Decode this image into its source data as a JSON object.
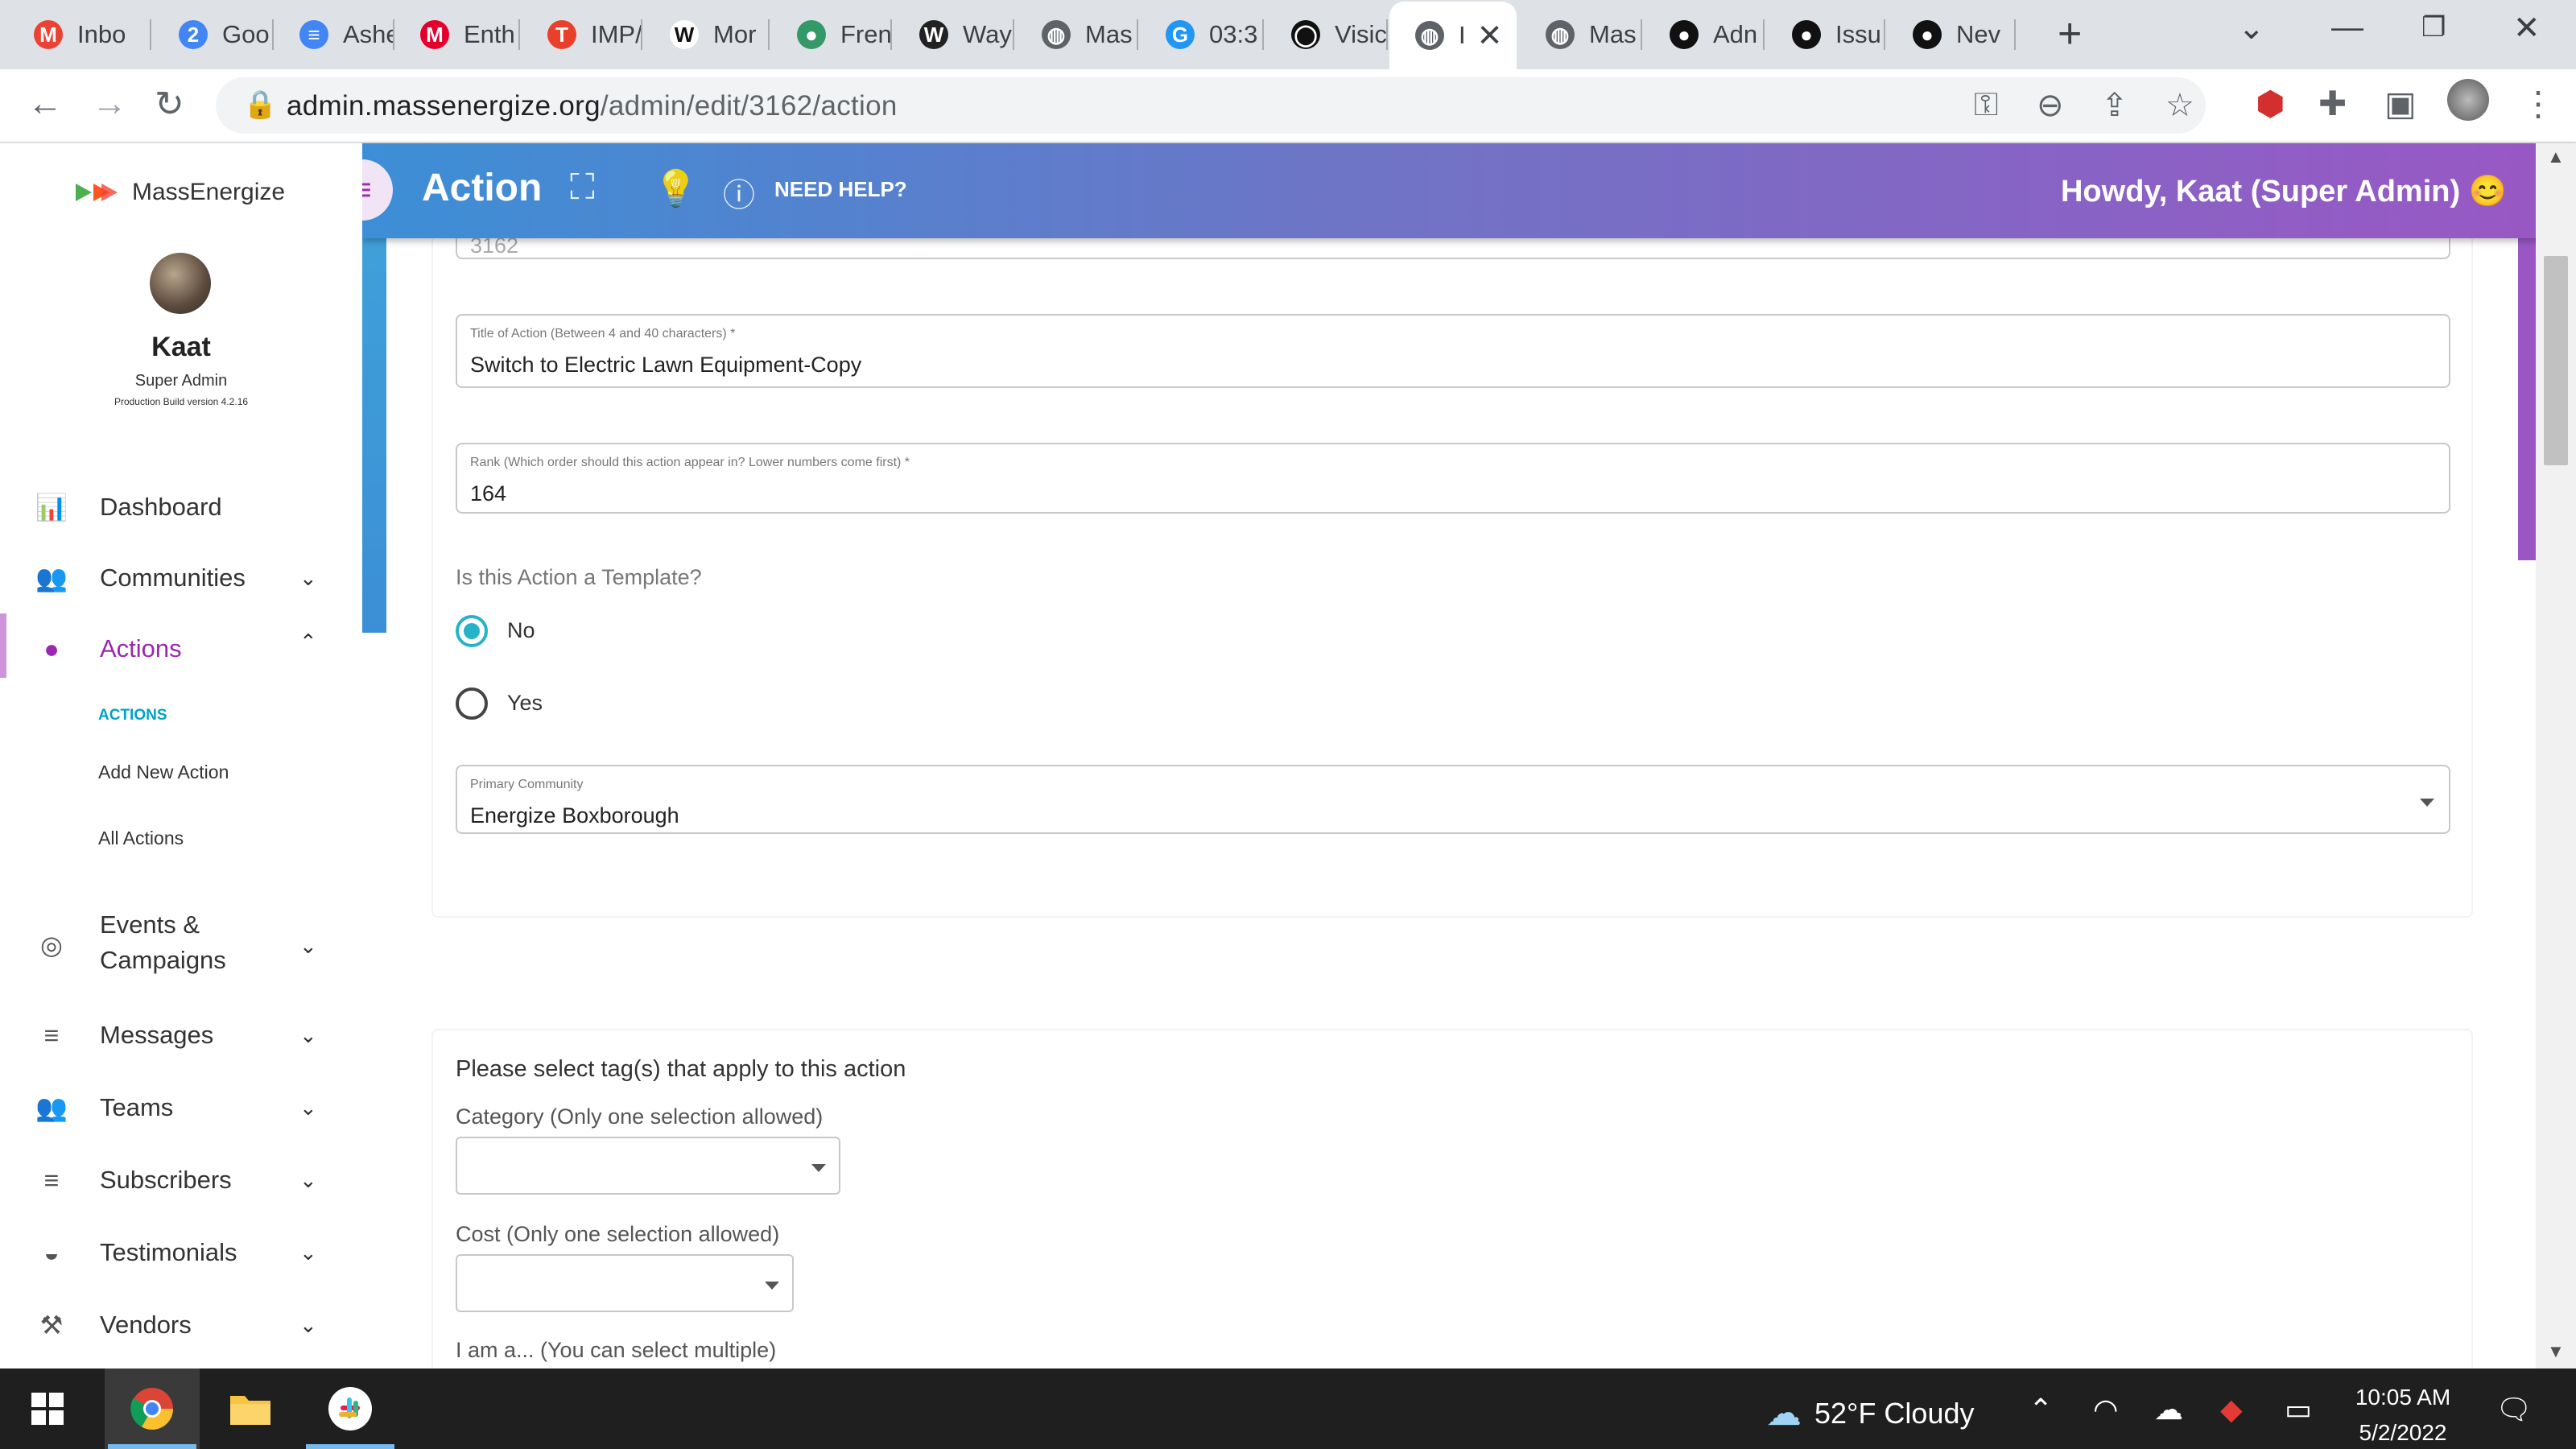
{
  "browser": {
    "tabs": [
      {
        "title": "Inbo",
        "icon": "gmail-icon",
        "color": "#ea4335",
        "glyph": "M"
      },
      {
        "title": "Goo",
        "icon": "google-calendar-icon",
        "color": "#4285f4",
        "glyph": "2"
      },
      {
        "title": "Ashe",
        "icon": "google-docs-icon",
        "color": "#4285f4",
        "glyph": "≡"
      },
      {
        "title": "Enth",
        "icon": "met-icon",
        "color": "#e4002b",
        "glyph": "M"
      },
      {
        "title": "IMP/",
        "icon": "t-icon",
        "color": "#e8402a",
        "glyph": "T"
      },
      {
        "title": "Mor",
        "icon": "wikipedia-icon",
        "color": "#ffffff",
        "glyph": "W"
      },
      {
        "title": "Fren",
        "icon": "wikimedia-icon",
        "color": "#339966",
        "glyph": "●"
      },
      {
        "title": "Way",
        "icon": "wayback-icon",
        "color": "#222222",
        "glyph": "W"
      },
      {
        "title": "Mas",
        "icon": "globe-icon",
        "color": "#5f6368",
        "glyph": "◍"
      },
      {
        "title": "03:3",
        "icon": "g-icon",
        "color": "#2196f3",
        "glyph": "G"
      },
      {
        "title": "Visic",
        "icon": "circle-icon",
        "color": "#111111",
        "glyph": "◯"
      },
      {
        "title": "I",
        "icon": "globe-icon",
        "color": "#5f6368",
        "glyph": "◍"
      },
      {
        "title": "Mas",
        "icon": "globe-icon",
        "color": "#5f6368",
        "glyph": "◍"
      },
      {
        "title": "Adn",
        "icon": "github-icon",
        "color": "#111111",
        "glyph": "●"
      },
      {
        "title": "Issu",
        "icon": "github-icon",
        "color": "#111111",
        "glyph": "●"
      },
      {
        "title": "Nev",
        "icon": "github-icon",
        "color": "#111111",
        "glyph": "●"
      }
    ],
    "url_host": "admin.massenergize.org",
    "url_path": "/admin/edit/3162/action"
  },
  "sidebar": {
    "brand": "MassEnergize",
    "user_name": "Kaat",
    "user_role": "Super Admin",
    "build": "Production Build version 4.2.16",
    "items": [
      {
        "label": "Dashboard",
        "icon": "bar-chart-icon",
        "glyph": "▮"
      },
      {
        "label": "Communities",
        "icon": "people-icon",
        "glyph": "👥"
      },
      {
        "label": "Actions",
        "icon": "lightbulb-icon",
        "glyph": "●"
      },
      {
        "label": "Events &",
        "label2": "Campaigns",
        "icon": "broadcast-icon",
        "glyph": "◎"
      },
      {
        "label": "Messages",
        "icon": "list-icon",
        "glyph": "≡"
      },
      {
        "label": "Teams",
        "icon": "people-icon",
        "glyph": "👥"
      },
      {
        "label": "Subscribers",
        "icon": "list-icon",
        "glyph": "≡"
      },
      {
        "label": "Testimonials",
        "icon": "chat-icon",
        "glyph": "◒"
      },
      {
        "label": "Vendors",
        "icon": "hammer-icon",
        "glyph": "⚒"
      }
    ],
    "subitems": [
      "ACTIONS",
      "Add New Action",
      "All Actions"
    ]
  },
  "header": {
    "title": "Action",
    "need_help": "NEED HELP?",
    "greeting": "Howdy, Kaat (Super Admin) 😊"
  },
  "form": {
    "id_value": "3162",
    "title_label": "Title of Action (Between 4 and 40 characters) *",
    "title_value": "Switch to Electric Lawn Equipment-Copy",
    "rank_label": "Rank (Which order should this action appear in? Lower numbers come first) *",
    "rank_value": "164",
    "template_question": "Is this Action a Template?",
    "template_options": [
      "No",
      "Yes"
    ],
    "template_selected": "No",
    "community_label": "Primary Community",
    "community_value": "Energize Boxborough"
  },
  "tags": {
    "heading": "Please select tag(s) that apply to this action",
    "category_label": "Category (Only one selection allowed)",
    "cost_label": "Cost (Only one selection allowed)",
    "iama_label": "I am a... (You can select multiple)"
  },
  "taskbar": {
    "weather": "52°F  Cloudy",
    "time": "10:05 AM",
    "date": "5/2/2022"
  },
  "colors": {
    "accent": "#9c27b0",
    "radio": "#26b3c9",
    "header_start": "#3c8fd6",
    "header_end": "#9a57c4"
  }
}
